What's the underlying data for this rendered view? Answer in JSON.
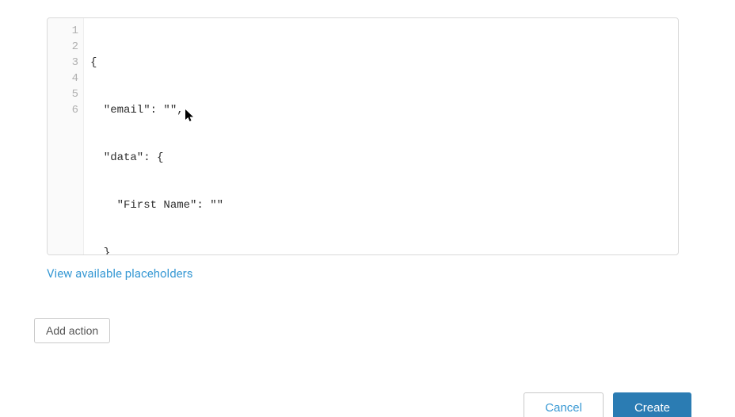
{
  "editor": {
    "lines": [
      "{",
      "  \"email\": \"\",",
      "  \"data\": {",
      "    \"First Name\": \"\"",
      "  }",
      "}"
    ]
  },
  "links": {
    "view_placeholders": "View available placeholders"
  },
  "buttons": {
    "add_action": "Add action",
    "cancel": "Cancel",
    "create": "Create"
  }
}
